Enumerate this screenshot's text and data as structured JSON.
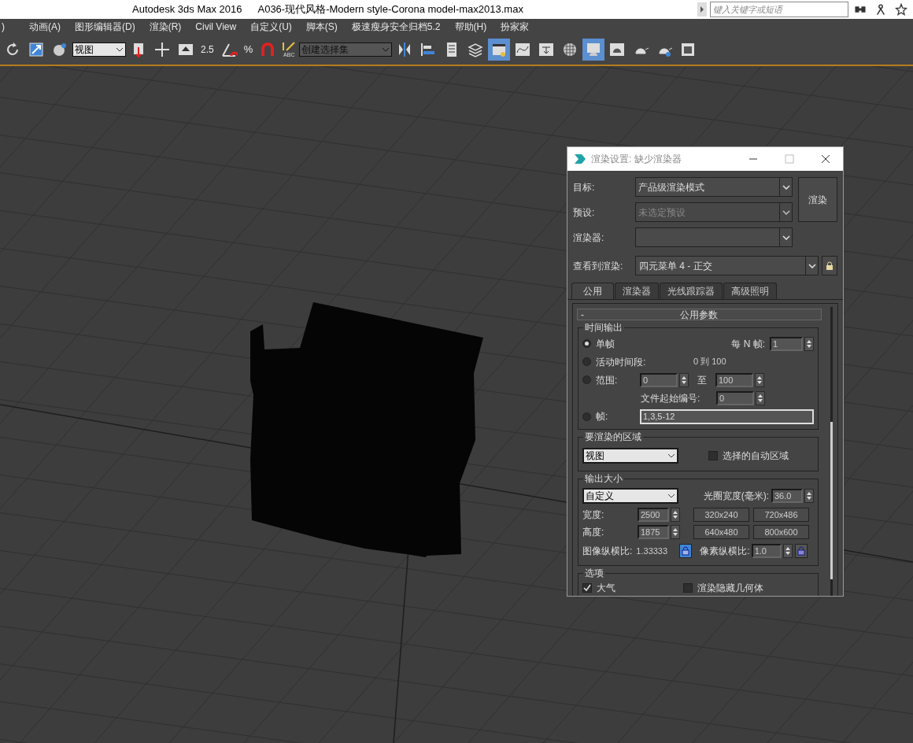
{
  "window": {
    "title": "Autodesk 3ds Max 2016",
    "file": "A036-现代风格-Modern style-Corona model-max2013.max",
    "search": {
      "placeholder": "键入关键字或短语"
    }
  },
  "menu": [
    ")",
    "动画(A)",
    "图形编辑器(D)",
    "渲染(R)",
    "Civil View",
    "自定义(U)",
    "脚本(S)",
    "极速瘦身安全归档5.2",
    "帮助(H)",
    "扮家家"
  ],
  "toolbar": {
    "view_dropdown": "视图",
    "snap_label": "2.5",
    "percent_label": "%",
    "abc_label": "ABC",
    "selection_set": "创建选择集"
  },
  "dialog": {
    "title": "渲染设置: 缺少渲染器",
    "render_button": "渲染",
    "fields": [
      {
        "label": "目标:",
        "value": "产品级渲染模式",
        "disabled": false
      },
      {
        "label": "预设:",
        "value": "未选定预设",
        "disabled": true
      },
      {
        "label": "渲染器:",
        "disabled": false
      }
    ],
    "view_label": "查看到渲染:",
    "view_value": "四元菜单 4 - 正交",
    "tabs": [
      {
        "label": "公用",
        "selected": true
      },
      {
        "label": "渲染器",
        "selected": false
      },
      {
        "label": "光线跟踪器",
        "selected": false
      },
      {
        "label": "高级照明",
        "selected": false
      }
    ],
    "rollout": {
      "collapse": "-",
      "title": "公用参数"
    },
    "time_output": {
      "title": "时间输出",
      "every_n_label": "每 N 帧:",
      "every_n_value": "1",
      "active_range": "0 到 100",
      "to_label": "至",
      "file_start_label": "文件起始编号:",
      "file_start_value": "0",
      "options": [
        {
          "label": "单帧",
          "selected": true
        },
        {
          "label": "活动时间段:",
          "selected": false
        },
        {
          "label": "范围:",
          "selected": false,
          "from": "0",
          "to": "100"
        },
        {
          "label": "帧:",
          "selected": false,
          "value": "1,3,5-12"
        }
      ]
    },
    "area": {
      "title": "要渲染的区域",
      "value": "视图",
      "auto_region": {
        "label": "选择的自动区域",
        "checked": false
      }
    },
    "output_size": {
      "title": "输出大小",
      "preset": "自定义",
      "aperture_label": "光圈宽度(毫米):",
      "aperture_value": "36.0",
      "width_label": "宽度:",
      "width_value": "2500",
      "height_label": "高度:",
      "height_value": "1875",
      "presets": [
        "320x240",
        "720x486",
        "640x480",
        "800x600"
      ],
      "image_aspect_label": "图像纵横比:",
      "image_aspect_value": "1.33333",
      "image_aspect_locked": true,
      "pixel_aspect_label": "像素纵横比:",
      "pixel_aspect_value": "1.0",
      "pixel_aspect_locked": false
    },
    "options": {
      "title": "选项",
      "items": [
        {
          "label": "大气",
          "checked": true
        },
        {
          "label": "渲染隐藏几何体",
          "checked": false
        }
      ]
    }
  }
}
